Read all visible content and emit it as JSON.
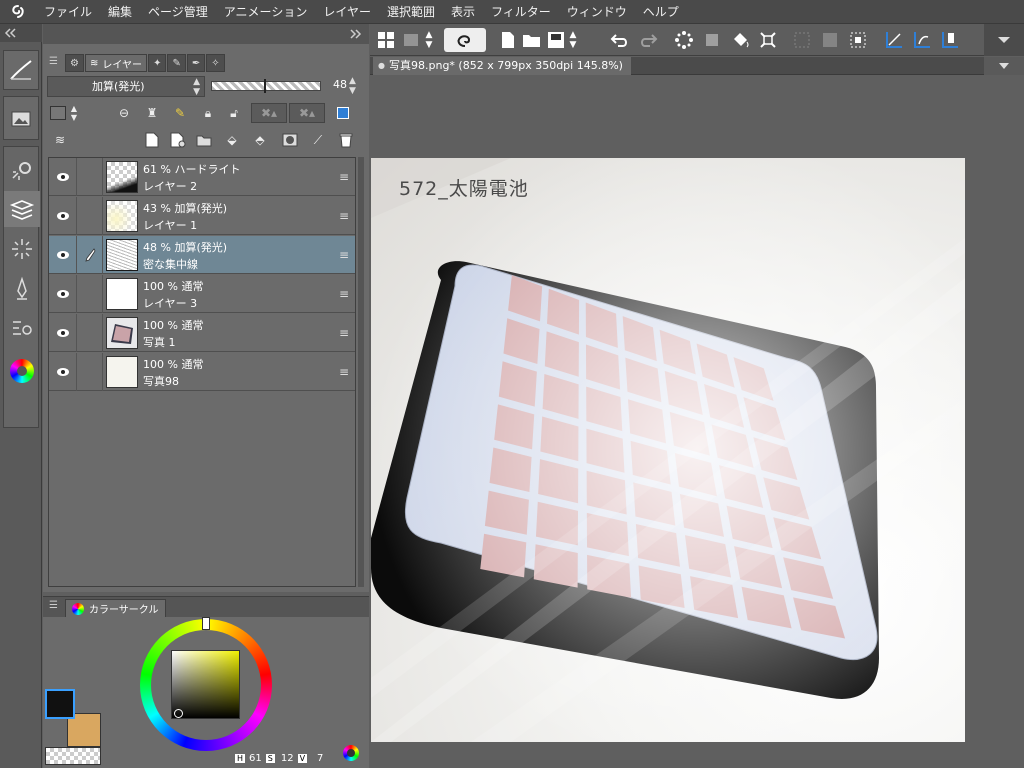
{
  "menubar": {
    "items": [
      "ファイル",
      "編集",
      "ページ管理",
      "アニメーション",
      "レイヤー",
      "選択範囲",
      "表示",
      "フィルター",
      "ウィンドウ",
      "ヘルプ"
    ]
  },
  "layer_panel": {
    "tab_label": "レイヤー",
    "blend_mode": "加算(発光)",
    "opacity": "48",
    "opacity_fraction": 0.48,
    "layers": [
      {
        "line1": "61 % ハードライト",
        "line2": "レイヤー 2",
        "selected": false,
        "pen": false,
        "thumb": "dark-corner"
      },
      {
        "line1": "43 % 加算(発光)",
        "line2": "レイヤー 1",
        "selected": false,
        "pen": false,
        "thumb": "check-yellow"
      },
      {
        "line1": "48 % 加算(発光)",
        "line2": "密な集中線",
        "selected": true,
        "pen": true,
        "thumb": "lines"
      },
      {
        "line1": "100 % 通常",
        "line2": "レイヤー 3",
        "selected": false,
        "pen": false,
        "thumb": "check"
      },
      {
        "line1": "100 % 通常",
        "line2": "写真 1",
        "selected": false,
        "pen": false,
        "thumb": "photo"
      },
      {
        "line1": "100 % 通常",
        "line2": "写真98",
        "selected": false,
        "pen": false,
        "thumb": "white"
      }
    ]
  },
  "color_panel": {
    "tab_label": "カラーサークル",
    "h_label": "H",
    "h_value": "61",
    "s_label": "S",
    "s_value": "12",
    "v_label": "V",
    "v_value": "7",
    "main_color": "#111111",
    "sub_color": "#d9a760"
  },
  "document": {
    "tab_title": "写真98.png* (852 x 799px 350dpi 145.8%)"
  },
  "canvas": {
    "caption": "572_太陽電池"
  },
  "colors": {
    "accent_blue": "#2f7fd6",
    "selected_layer": "#6f8795"
  }
}
